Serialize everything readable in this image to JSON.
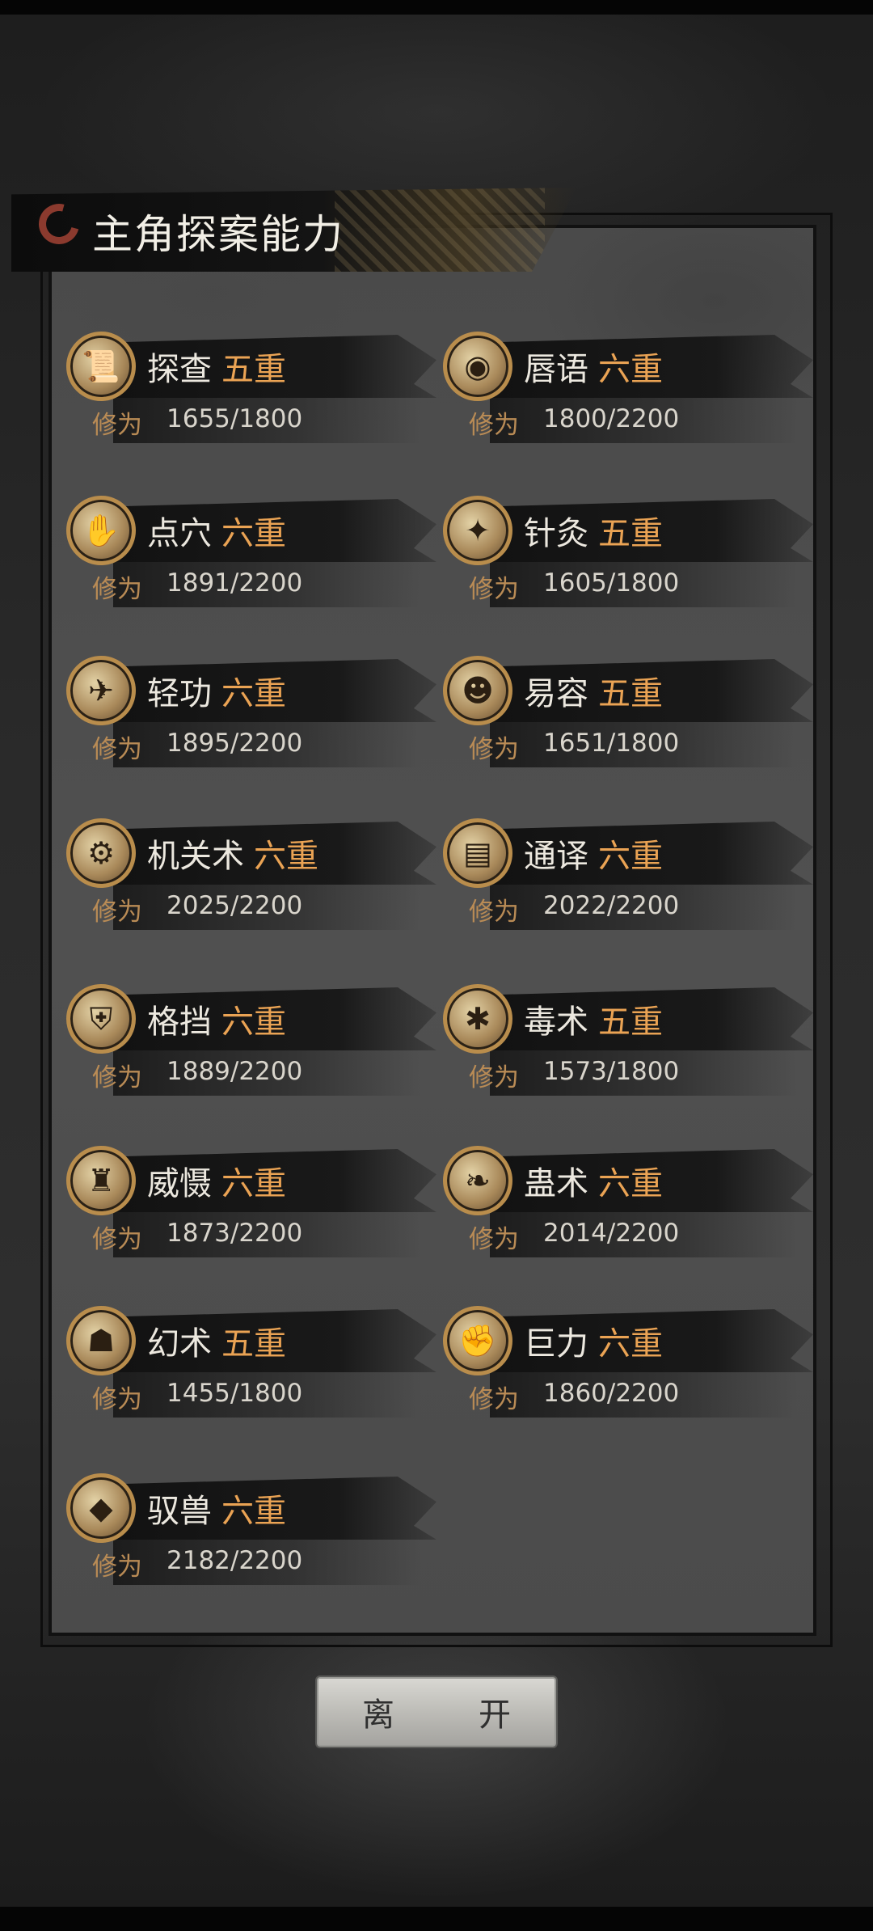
{
  "title": "主角探案能力",
  "exp_label": "修为",
  "leave_button": "离　开",
  "skills": [
    {
      "name": "探查",
      "level": "五重",
      "exp": "1655/1800",
      "icon": "scroll-icon",
      "glyph": "📜"
    },
    {
      "name": "唇语",
      "level": "六重",
      "exp": "1800/2200",
      "icon": "lips-mask-icon",
      "glyph": "◉"
    },
    {
      "name": "点穴",
      "level": "六重",
      "exp": "1891/2200",
      "icon": "finger-strike-icon",
      "glyph": "✋"
    },
    {
      "name": "针灸",
      "level": "五重",
      "exp": "1605/1800",
      "icon": "needle-icon",
      "glyph": "✦"
    },
    {
      "name": "轻功",
      "level": "六重",
      "exp": "1895/2200",
      "icon": "leaping-figure-icon",
      "glyph": "✈"
    },
    {
      "name": "易容",
      "level": "五重",
      "exp": "1651/1800",
      "icon": "disguise-mask-icon",
      "glyph": "☻"
    },
    {
      "name": "机关术",
      "level": "六重",
      "exp": "2025/2200",
      "icon": "gear-icon",
      "glyph": "⚙"
    },
    {
      "name": "通译",
      "level": "六重",
      "exp": "2022/2200",
      "icon": "books-icon",
      "glyph": "▤"
    },
    {
      "name": "格挡",
      "level": "六重",
      "exp": "1889/2200",
      "icon": "shield-block-icon",
      "glyph": "⛨"
    },
    {
      "name": "毒术",
      "level": "五重",
      "exp": "1573/1800",
      "icon": "spider-icon",
      "glyph": "✱"
    },
    {
      "name": "威慑",
      "level": "六重",
      "exp": "1873/2200",
      "icon": "warrior-stance-icon",
      "glyph": "♜"
    },
    {
      "name": "蛊术",
      "level": "六重",
      "exp": "2014/2200",
      "icon": "larva-icon",
      "glyph": "❧"
    },
    {
      "name": "幻术",
      "level": "五重",
      "exp": "1455/1800",
      "icon": "hooded-figure-icon",
      "glyph": "☗"
    },
    {
      "name": "巨力",
      "level": "六重",
      "exp": "1860/2200",
      "icon": "fist-icon",
      "glyph": "✊"
    },
    {
      "name": "驭兽",
      "level": "六重",
      "exp": "2182/2200",
      "icon": "wolf-head-icon",
      "glyph": "◆"
    }
  ],
  "colors": {
    "level_text": "#eaa354",
    "exp_label": "#b98b55",
    "icon_ring": "#b98d4c",
    "title_logo": "#8b3a2e"
  }
}
